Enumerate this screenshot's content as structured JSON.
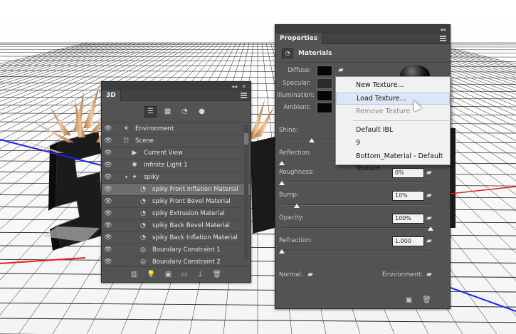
{
  "colors": {
    "panel_bg": "#535353",
    "panel_dark": "#424242",
    "selected_row": "#6d6d6d",
    "menu_bg": "#f1f1f1",
    "menu_hover": "#dbe6f6",
    "floor_line": "#222222",
    "axis_red": "#e81d1d",
    "axis_blue": "#2020ff",
    "spike_color": "#e0a870"
  },
  "panel_3d": {
    "title": "3D",
    "toolbar_icons": [
      "whole-scene-icon",
      "meshes-icon",
      "materials-icon",
      "lights-icon"
    ],
    "layers": [
      {
        "name": "Environment",
        "icon": "environment-icon",
        "indent": 0,
        "expanded": false
      },
      {
        "name": "Scene",
        "icon": "scene-icon",
        "indent": 0,
        "expanded": false
      },
      {
        "name": "Current View",
        "icon": "camera-icon",
        "indent": 1,
        "expanded": false
      },
      {
        "name": "Infinite Light 1",
        "icon": "light-icon",
        "indent": 1,
        "expanded": false
      },
      {
        "name": "spiky",
        "icon": "mesh-icon",
        "indent": 1,
        "expanded": true
      },
      {
        "name": "spiky Front Inflation Material",
        "icon": "material-icon",
        "indent": 2,
        "selected": true
      },
      {
        "name": "spiky Front Bevel Material",
        "icon": "material-icon",
        "indent": 2
      },
      {
        "name": "spiky Extrusion Material",
        "icon": "material-icon",
        "indent": 2
      },
      {
        "name": "spiky Back Bevel Material",
        "icon": "material-icon",
        "indent": 2
      },
      {
        "name": "spiky Back Inflation Material",
        "icon": "material-icon",
        "indent": 2
      },
      {
        "name": "Boundary Constraint 1",
        "icon": "constraint-icon",
        "indent": 2
      },
      {
        "name": "Boundary Constraint 2",
        "icon": "constraint-icon",
        "indent": 2
      }
    ],
    "bottom_icons": [
      "render-icon",
      "add-light-icon",
      "new-mesh-icon",
      "delete-icon"
    ]
  },
  "properties": {
    "title": "Properties",
    "section": "Materials",
    "texture_labels": {
      "diffuse": "Diffuse:",
      "specular": "Specular:",
      "illumination": "Illumination:",
      "ambient": "Ambient:"
    },
    "sliders": {
      "shine": {
        "label": "Shine:"
      },
      "reflection": {
        "label": "Reflection:"
      },
      "roughness": {
        "label": "Roughness:",
        "value": "0%",
        "level": 0.0
      },
      "bump": {
        "label": "Bump:",
        "value": "10%",
        "level": 0.1
      },
      "opacity": {
        "label": "Opacity:",
        "value": "100%",
        "level": 1.0
      },
      "refraction": {
        "label": "Refraction:",
        "value": "1.000",
        "level": 0.0
      }
    },
    "normal_label": "Normal:",
    "environment_label": "Environment:"
  },
  "texture_menu": {
    "items": [
      {
        "label": "New Texture...",
        "state": "normal"
      },
      {
        "label": "Load Texture...",
        "state": "hover"
      },
      {
        "label": "Remove Texture",
        "state": "disabled"
      },
      {
        "label": "Default IBL",
        "state": "normal"
      },
      {
        "label": "9",
        "state": "normal"
      },
      {
        "label": "Bottom_Material - Default Texture",
        "state": "normal"
      }
    ]
  }
}
